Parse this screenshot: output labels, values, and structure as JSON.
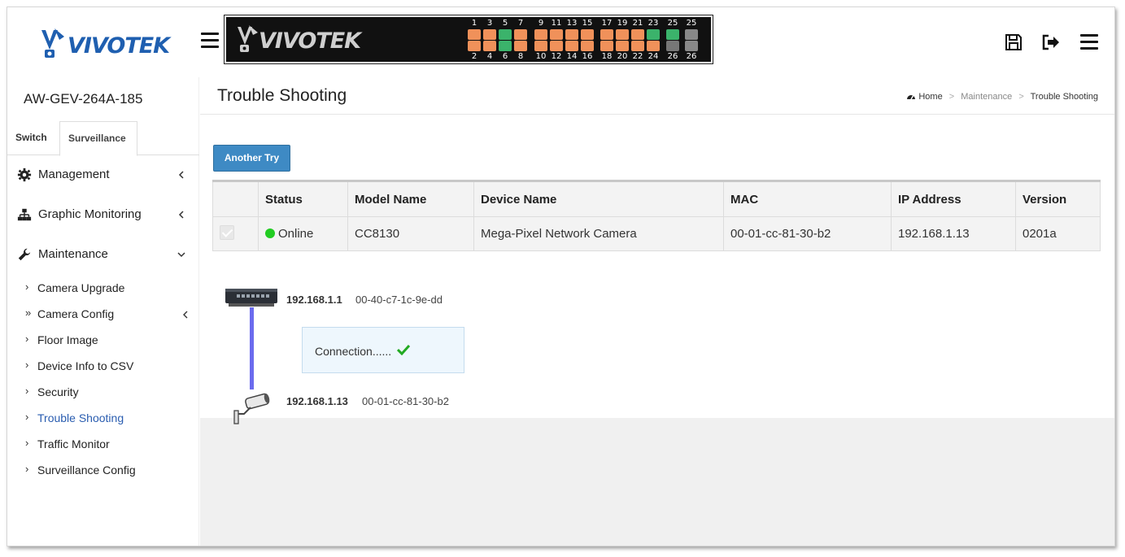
{
  "brand": {
    "logo_text": "VIVOTEK"
  },
  "panel": {
    "logo_text": "VIVOTEK",
    "top_ports": [
      "1",
      "3",
      "5",
      "7",
      "9",
      "11",
      "13",
      "15",
      "17",
      "19",
      "21",
      "23",
      "25",
      "25"
    ],
    "bottom_ports": [
      "2",
      "4",
      "6",
      "8",
      "10",
      "12",
      "14",
      "16",
      "18",
      "20",
      "22",
      "24",
      "26",
      "26"
    ]
  },
  "header_icons": {
    "save": "save-icon",
    "logout": "logout-icon",
    "menu": "menu-icon"
  },
  "sidebar": {
    "device_name": "AW-GEV-264A-185",
    "tabs": [
      {
        "label": "Switch"
      },
      {
        "label": "Surveillance"
      }
    ],
    "groups": [
      {
        "label": "Management",
        "icon": "gear-icon"
      },
      {
        "label": "Graphic Monitoring",
        "icon": "sitemap-icon"
      },
      {
        "label": "Maintenance",
        "icon": "wrench-icon"
      }
    ],
    "items": [
      {
        "label": "Camera Upgrade"
      },
      {
        "label": "Camera Config"
      },
      {
        "label": "Floor Image"
      },
      {
        "label": "Device Info to CSV"
      },
      {
        "label": "Security"
      },
      {
        "label": "Trouble Shooting"
      },
      {
        "label": "Traffic Monitor"
      },
      {
        "label": "Surveillance Config"
      }
    ]
  },
  "page": {
    "title": "Trouble Shooting",
    "breadcrumb": {
      "home": "Home",
      "parent": "Maintenance",
      "current": "Trouble Shooting"
    },
    "button": "Another Try"
  },
  "table": {
    "headers": [
      "Status",
      "Model Name",
      "Device Name",
      "MAC",
      "IP Address",
      "Version"
    ],
    "row": {
      "status": "Online",
      "model": "CC8130",
      "device": "Mega-Pixel Network Camera",
      "mac": "00-01-cc-81-30-b2",
      "ip": "192.168.1.13",
      "version": "0201a"
    }
  },
  "topology": {
    "switch": {
      "ip": "192.168.1.1",
      "mac": "00-40-c7-1c-9e-dd"
    },
    "camera": {
      "ip": "192.168.1.13",
      "mac": "00-01-cc-81-30-b2"
    },
    "connection": "Connection......"
  },
  "colors": {
    "accent": "#3e8ac4",
    "link_active": "#2a5db0",
    "online": "#22cc22",
    "port_orange": "#f0915a",
    "port_green": "#3bb36b",
    "line": "#6b6bee"
  }
}
